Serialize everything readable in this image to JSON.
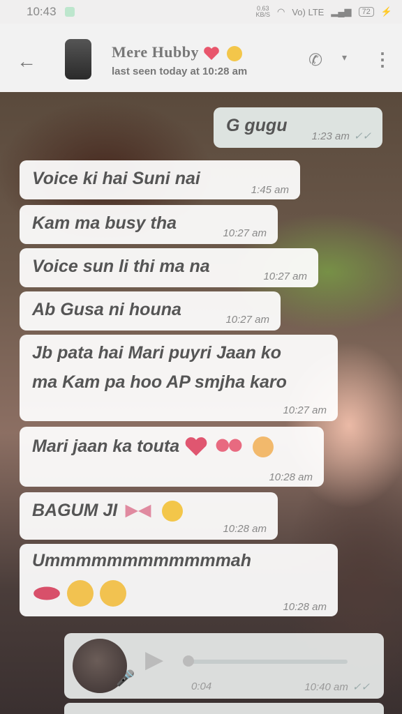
{
  "status_bar": {
    "time": "10:43",
    "speed_value": "0.63",
    "speed_unit": "KB/S",
    "network": "Vo) LTE",
    "battery": "72"
  },
  "header": {
    "contact_name": "Mere Hubby",
    "last_seen": "last seen today at 10:28 am"
  },
  "messages": [
    {
      "text": "G gugu",
      "time": "1:23 am",
      "direction": "outgoing"
    },
    {
      "text": "Voice ki hai Suni nai",
      "time": "1:45 am",
      "direction": "incoming"
    },
    {
      "text": "Kam ma busy tha",
      "time": "10:27 am",
      "direction": "incoming"
    },
    {
      "text": "Voice sun li thi ma na",
      "time": "10:27 am",
      "direction": "incoming"
    },
    {
      "text": "Ab Gusa ni houna",
      "time": "10:27 am",
      "direction": "incoming"
    },
    {
      "line1": "Jb pata hai Mari puyri Jaan ko",
      "line2": "ma Kam pa hoo AP smjha karo",
      "time": "10:27 am",
      "direction": "incoming"
    },
    {
      "text": "Mari jaan ka touta",
      "time": "10:28 am",
      "direction": "incoming"
    },
    {
      "text": "BAGUM JI",
      "time": "10:28 am",
      "direction": "incoming"
    },
    {
      "text": "Ummmmmmmmmmmmah",
      "time": "10:28 am",
      "direction": "incoming"
    }
  ],
  "voice_note": {
    "duration": "0:04",
    "time": "10:40 am"
  },
  "colors": {
    "bubble_in": "#ffffff",
    "bubble_out": "#e8f0ee",
    "text": "#555555"
  }
}
